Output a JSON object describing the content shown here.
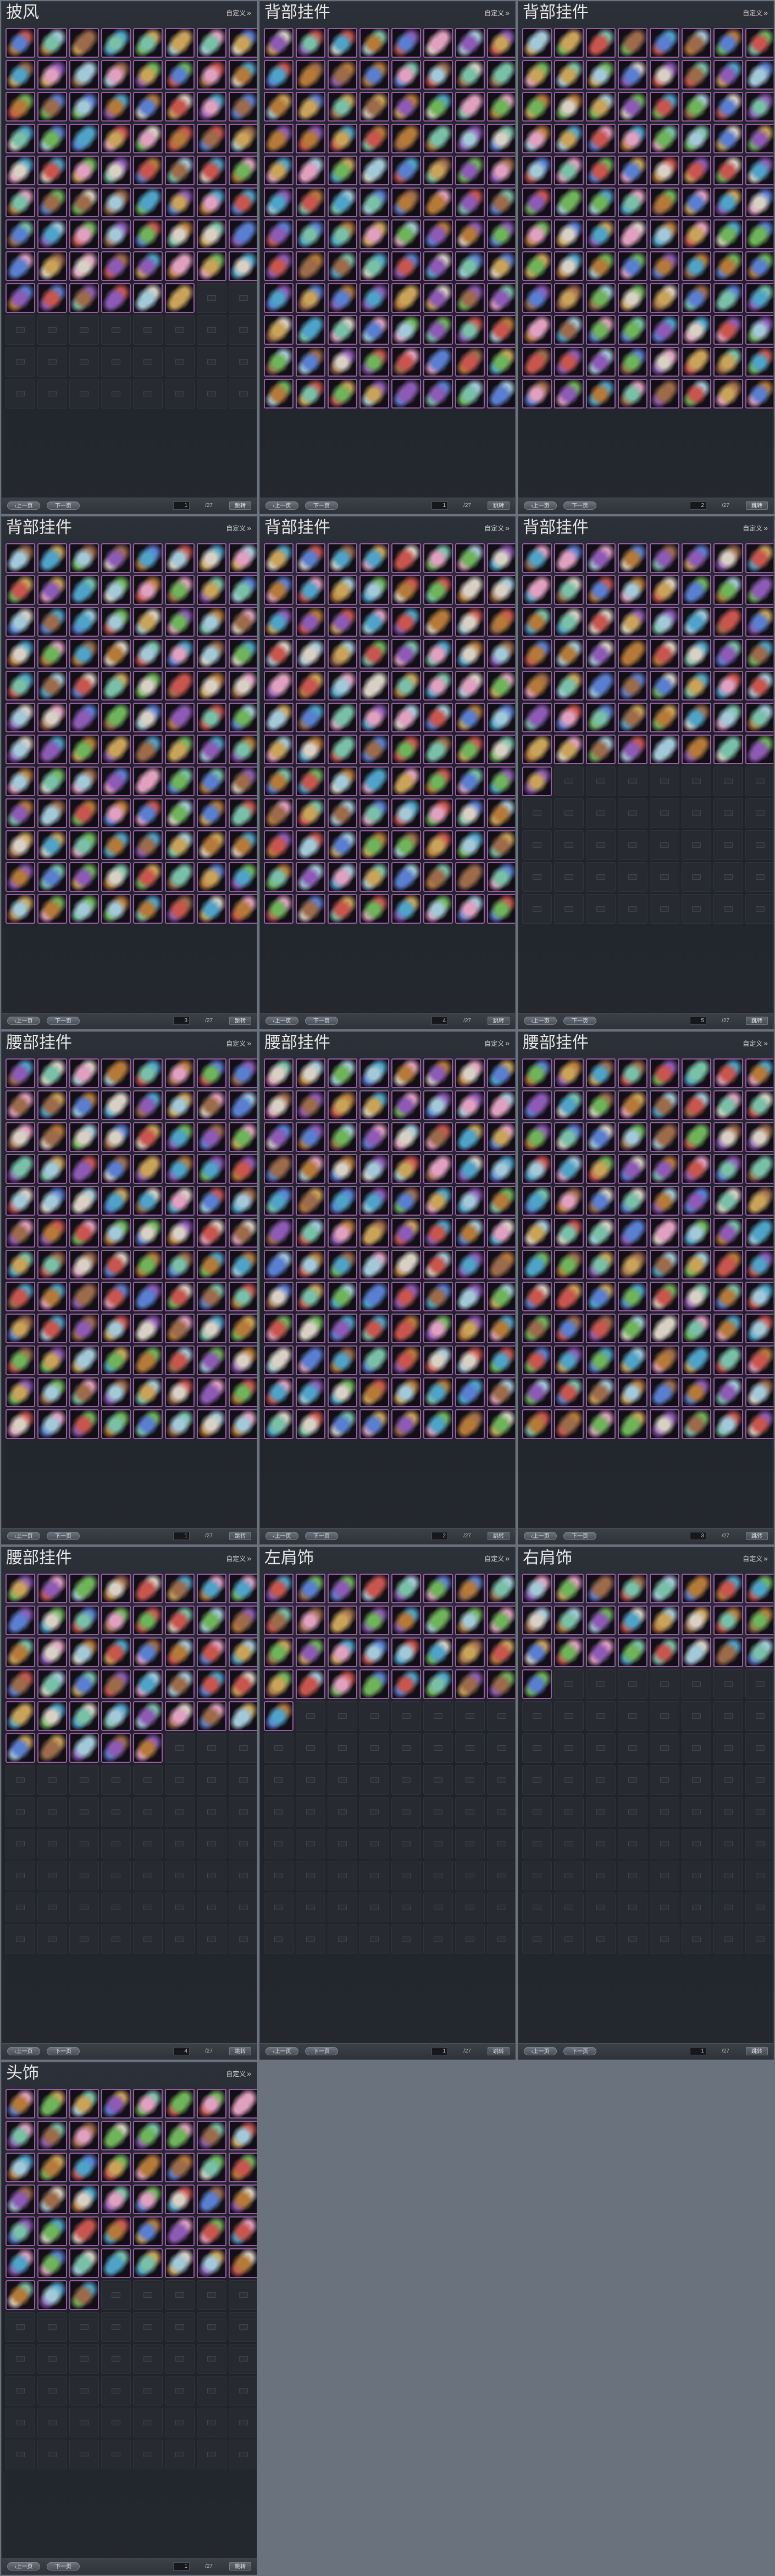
{
  "common": {
    "customize_label": "自定义",
    "customize_icon": "double-chevron-right-icon",
    "prev_label": "上一页",
    "next_label": "下一页",
    "jump_label": "跳转",
    "page_total": "/27"
  },
  "colors": {
    "slot_border": "#9a5aa6",
    "panel_bg": "#24282f",
    "page_bg": "#6a737d"
  },
  "panels": [
    {
      "title": "披风",
      "filled": 70,
      "page": "1"
    },
    {
      "title": "背部挂件",
      "filled": 96,
      "page": "1"
    },
    {
      "title": "背部挂件",
      "filled": 96,
      "page": "2"
    },
    {
      "title": "背部挂件",
      "filled": 96,
      "page": "3"
    },
    {
      "title": "背部挂件",
      "filled": 96,
      "page": "4"
    },
    {
      "title": "背部挂件",
      "filled": 57,
      "page": "5"
    },
    {
      "title": "腰部挂件",
      "filled": 96,
      "page": "1"
    },
    {
      "title": "腰部挂件",
      "filled": 96,
      "page": "2"
    },
    {
      "title": "腰部挂件",
      "filled": 96,
      "page": "3"
    },
    {
      "title": "腰部挂件",
      "filled": 45,
      "page": "4"
    },
    {
      "title": "左肩饰",
      "filled": 33,
      "page": "1"
    },
    {
      "title": "右肩饰",
      "filled": 25,
      "page": "1"
    },
    {
      "title": "头饰",
      "filled": 51,
      "page": "1"
    }
  ]
}
